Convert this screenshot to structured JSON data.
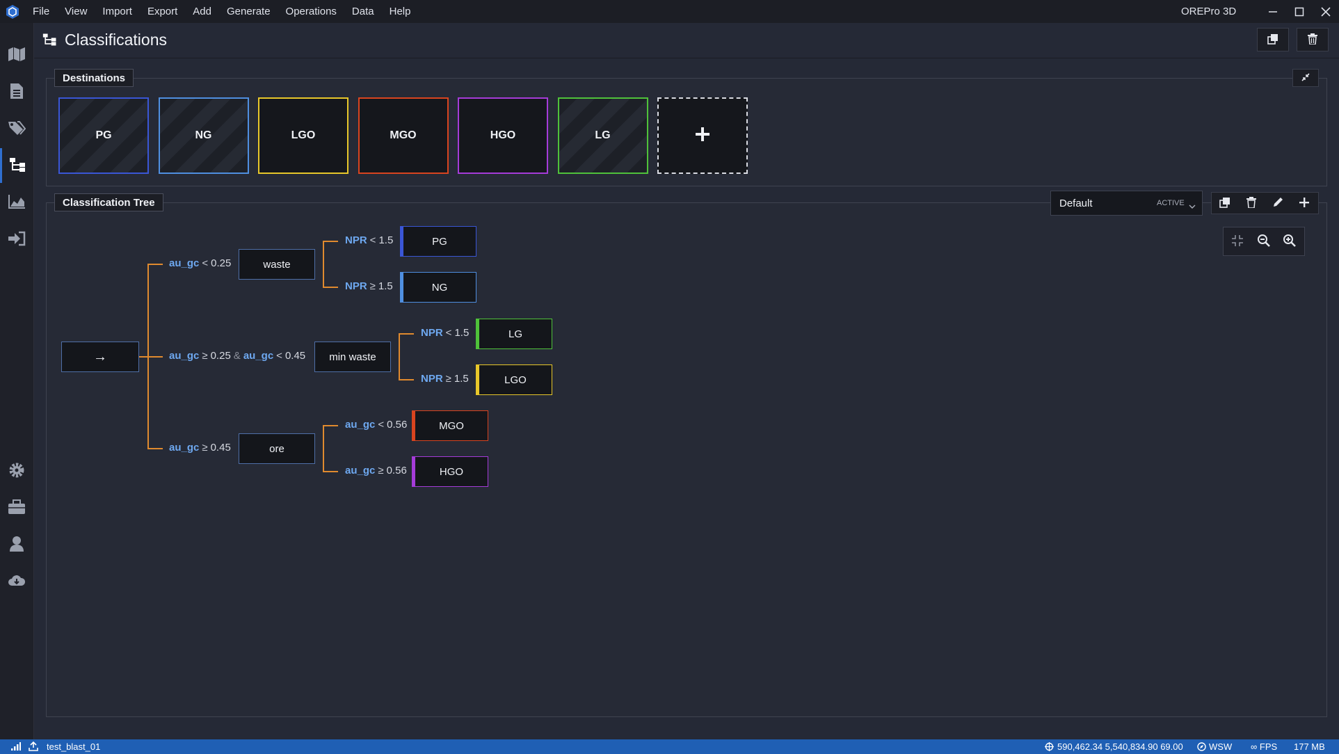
{
  "app": {
    "name": "OREPro 3D"
  },
  "menu": [
    "File",
    "View",
    "Import",
    "Export",
    "Add",
    "Generate",
    "Operations",
    "Data",
    "Help"
  ],
  "sidebar": [
    {
      "icon": "map-icon"
    },
    {
      "icon": "document-icon"
    },
    {
      "icon": "tags-icon"
    },
    {
      "icon": "classification-tree-icon"
    },
    {
      "icon": "chart-area-icon"
    },
    {
      "icon": "sign-in-icon"
    },
    {
      "icon": "gear-icon"
    },
    {
      "icon": "briefcase-icon"
    },
    {
      "icon": "user-icon"
    },
    {
      "icon": "cloud-download-icon"
    }
  ],
  "header": {
    "title": "Classifications"
  },
  "destinations": {
    "label": "Destinations",
    "tiles": [
      {
        "name": "PG",
        "color": "#3a56d6"
      },
      {
        "name": "NG",
        "color": "#4f8fe0"
      },
      {
        "name": "LGO",
        "color": "#e8c72a"
      },
      {
        "name": "MGO",
        "color": "#d9441f"
      },
      {
        "name": "HGO",
        "color": "#a53bd9"
      },
      {
        "name": "LG",
        "color": "#4fc23a"
      }
    ],
    "add_label": "+"
  },
  "tree": {
    "label": "Classification Tree",
    "selector": {
      "name": "Default",
      "badge": "ACTIVE"
    },
    "root_symbol": "→",
    "branches": [
      {
        "condition": [
          {
            "var": "au_gc",
            "op": "<",
            "val": "0.25"
          }
        ],
        "node": "waste",
        "children": [
          {
            "condition": [
              {
                "var": "NPR",
                "op": "<",
                "val": "1.5"
              }
            ],
            "dest": "PG",
            "color": "#3a56d6"
          },
          {
            "condition": [
              {
                "var": "NPR",
                "op": "≥",
                "val": "1.5"
              }
            ],
            "dest": "NG",
            "color": "#4f8fe0"
          }
        ]
      },
      {
        "condition": [
          {
            "var": "au_gc",
            "op": "≥",
            "val": "0.25"
          },
          {
            "var": "au_gc",
            "op": "<",
            "val": "0.45"
          }
        ],
        "joiner": "&",
        "node": "min waste",
        "children": [
          {
            "condition": [
              {
                "var": "NPR",
                "op": "<",
                "val": "1.5"
              }
            ],
            "dest": "LG",
            "color": "#4fc23a"
          },
          {
            "condition": [
              {
                "var": "NPR",
                "op": "≥",
                "val": "1.5"
              }
            ],
            "dest": "LGO",
            "color": "#e8c72a"
          }
        ]
      },
      {
        "condition": [
          {
            "var": "au_gc",
            "op": "≥",
            "val": "0.45"
          }
        ],
        "node": "ore",
        "children": [
          {
            "condition": [
              {
                "var": "au_gc",
                "op": "<",
                "val": "0.56"
              }
            ],
            "dest": "MGO",
            "color": "#d9441f"
          },
          {
            "condition": [
              {
                "var": "au_gc",
                "op": "≥",
                "val": "0.56"
              }
            ],
            "dest": "HGO",
            "color": "#a53bd9"
          }
        ]
      }
    ]
  },
  "status": {
    "project": "test_blast_01",
    "coords": "590,462.34 5,540,834.90 69.00",
    "direction": "WSW",
    "fps": "∞ FPS",
    "memory": "177 MB"
  }
}
